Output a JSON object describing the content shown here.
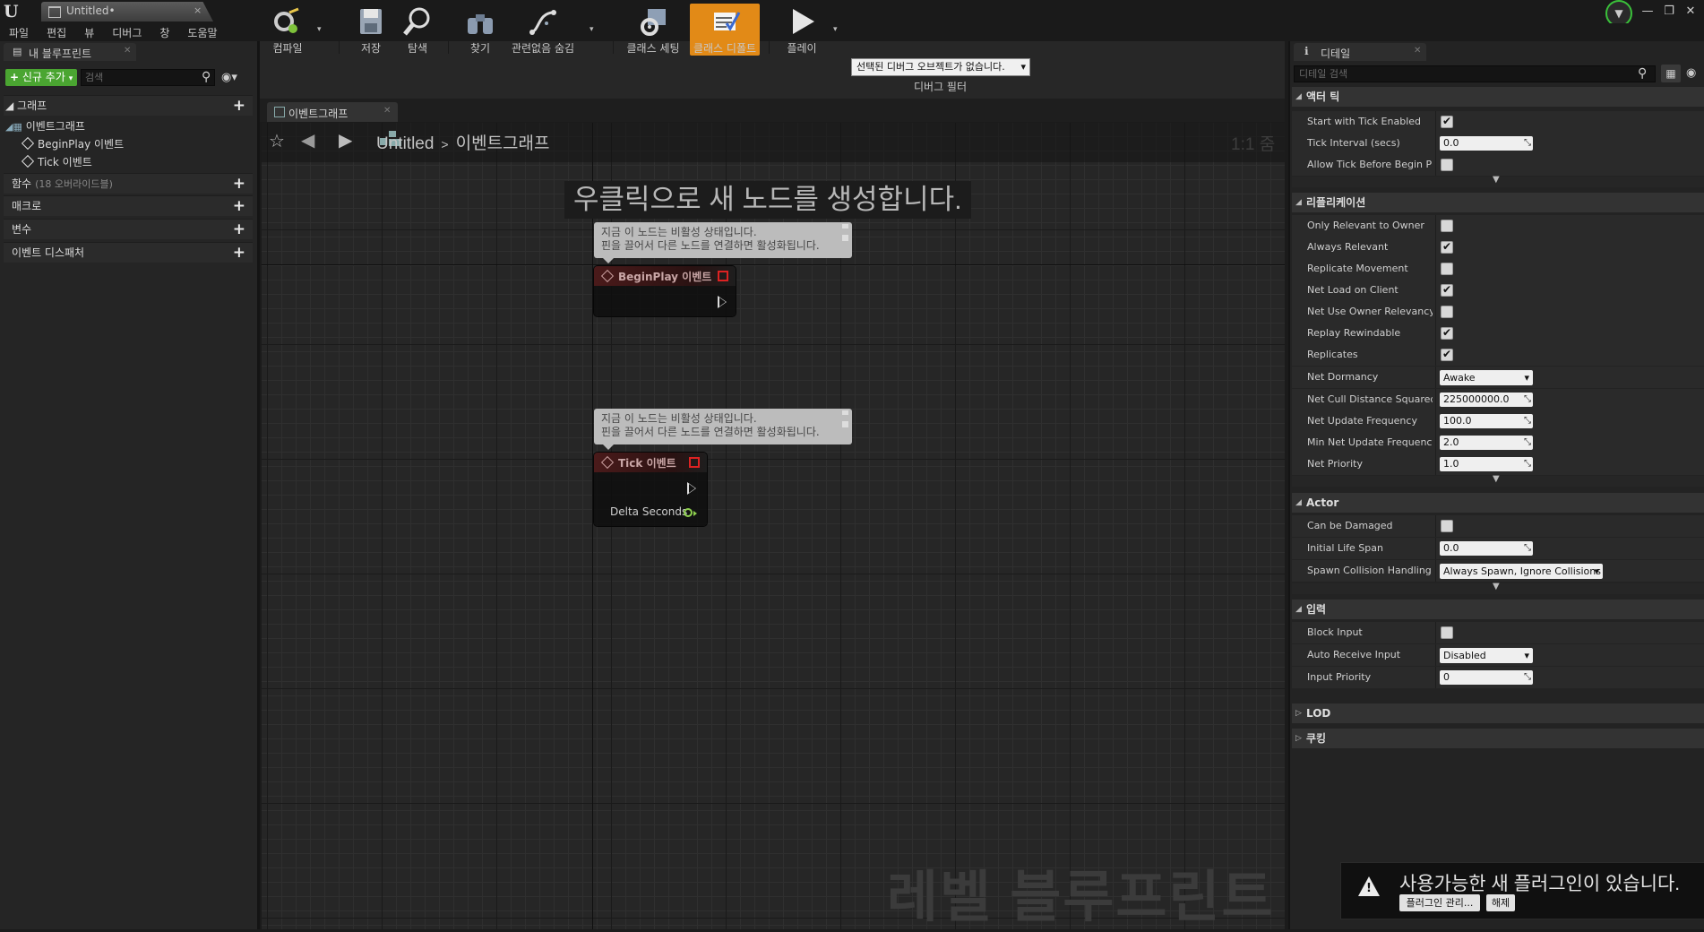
{
  "window": {
    "tab_title": "Untitled•",
    "tab_close": "×",
    "controls": [
      "—",
      "❐",
      "✕"
    ]
  },
  "menu": [
    "파일",
    "편집",
    "뷰",
    "디버그",
    "창",
    "도움말"
  ],
  "left_panel": {
    "tab_title": "내 블루프린트",
    "add_new": "신규 추가",
    "search_placeholder": "검색",
    "graph_section": "그래프",
    "event_graph": "이벤트그래프",
    "events": [
      "BeginPlay 이벤트",
      "Tick 이벤트"
    ],
    "functions": "함수",
    "functions_sub": "(18 오버라이드블)",
    "macros": "매크로",
    "variables": "변수",
    "dispatchers": "이벤트 디스패처"
  },
  "toolbar": {
    "compile": "컴파일",
    "save": "저장",
    "browse": "탐색",
    "find": "찾기",
    "hide_unrelated": "관련없음 숨김",
    "class_settings": "클래스 세팅",
    "class_defaults": "클래스 디폴트",
    "play": "플레이",
    "debug_select": "선택된 디버그 오브젝트가 없습니다.",
    "debug_filter": "디버그 필터"
  },
  "graph": {
    "tab_title": "이벤트그래프",
    "breadcrumb_root": "Untitled",
    "breadcrumb_sep": ">",
    "breadcrumb_leaf": "이벤트그래프",
    "zoom": "1:1 줌",
    "hint": "우클릭으로 새 노드를 생성합니다.",
    "watermark": "레벨 블루프린트",
    "comment_line1": "지금 이 노드는 비활성 상태입니다.",
    "comment_line2": "핀을 끌어서 다른 노드를 연결하면 활성화됩니다.",
    "node_beginplay": "BeginPlay 이벤트",
    "node_tick": "Tick 이벤트",
    "pin_delta": "Delta Seconds"
  },
  "details": {
    "tab_title": "디테일",
    "search_placeholder": "디테일 검색",
    "cat_tick": "액터 틱",
    "start_with_tick": "Start with Tick Enabled",
    "tick_interval": "Tick Interval (secs)",
    "tick_interval_val": "0.0",
    "allow_tick": "Allow Tick Before Begin Play",
    "cat_replication": "리플리케이션",
    "only_relevant": "Only Relevant to Owner",
    "always_relevant": "Always Relevant",
    "replicate_movement": "Replicate Movement",
    "net_load": "Net Load on Client",
    "net_use_owner": "Net Use Owner Relevancy",
    "replay_rewindable": "Replay Rewindable",
    "replicates": "Replicates",
    "net_dormancy": "Net Dormancy",
    "net_dormancy_val": "Awake",
    "net_cull": "Net Cull Distance Squared",
    "net_cull_val": "225000000.0",
    "net_update": "Net Update Frequency",
    "net_update_val": "100.0",
    "min_net_update": "Min Net Update Frequency",
    "min_net_update_val": "2.0",
    "net_priority": "Net Priority",
    "net_priority_val": "1.0",
    "cat_actor": "Actor",
    "can_be_damaged": "Can be Damaged",
    "initial_life": "Initial Life Span",
    "initial_life_val": "0.0",
    "spawn_collision": "Spawn Collision Handling Me",
    "spawn_collision_val": "Always Spawn, Ignore Collisions",
    "cat_input": "입력",
    "block_input": "Block Input",
    "auto_receive": "Auto Receive Input",
    "auto_receive_val": "Disabled",
    "input_priority": "Input Priority",
    "input_priority_val": "0",
    "cat_lod": "LOD",
    "cat_cooking": "쿠킹"
  },
  "notification": {
    "text": "사용가능한 새 플러그인이 있습니다.",
    "manage": "플러그인 관리...",
    "dismiss": "해제"
  },
  "colors": {
    "accent_orange": "#e28a17",
    "add_green": "#4aa531",
    "event_red": "#d22222",
    "float_pin": "#8fd14f"
  }
}
